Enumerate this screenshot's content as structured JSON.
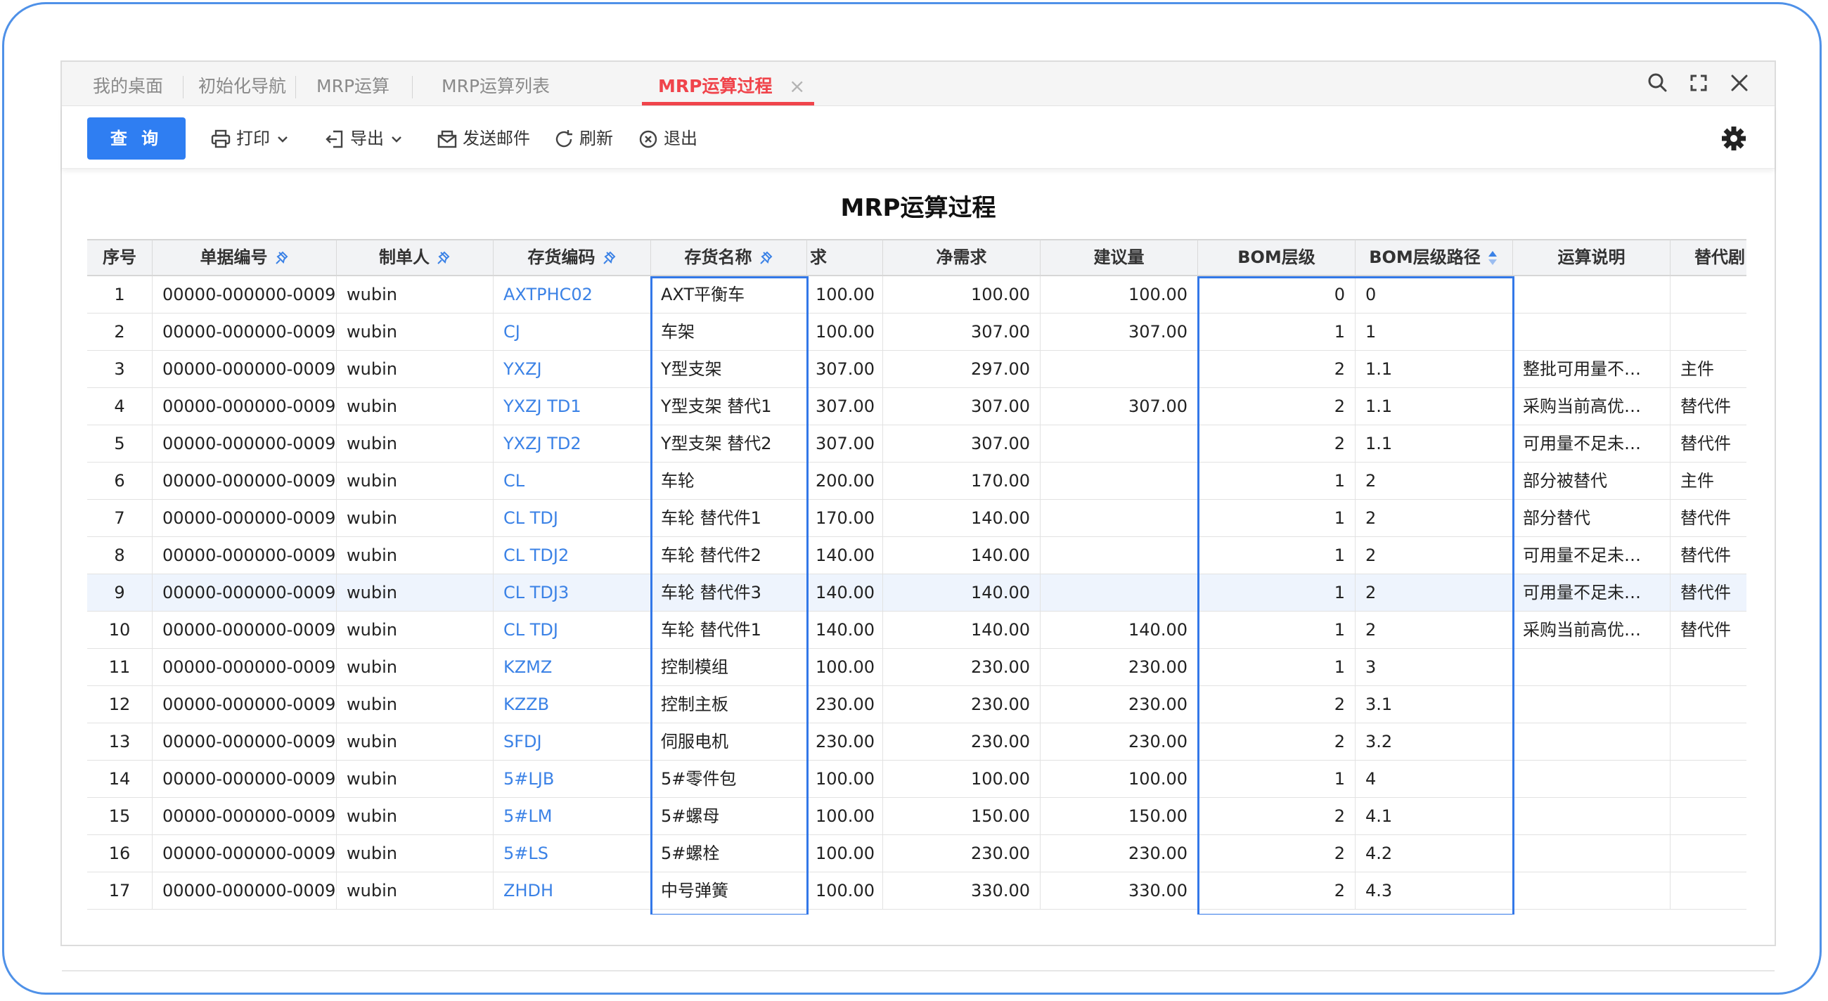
{
  "tabs": [
    {
      "label": "我的桌面",
      "active": false
    },
    {
      "label": "初始化导航",
      "active": false
    },
    {
      "label": "MRP运算",
      "active": false
    },
    {
      "label": "MRP运算列表",
      "active": false
    },
    {
      "label": "MRP运算过程",
      "active": true
    }
  ],
  "toolbar": {
    "query": "查 询",
    "print": "打印",
    "export": "导出",
    "email": "发送邮件",
    "refresh": "刷新",
    "exit": "退出"
  },
  "report_title": "MRP运算过程",
  "columns": {
    "seq": "序号",
    "doc_no": "单据编号",
    "maker": "制单人",
    "inv_code": "存货编码",
    "inv_name": "存货名称",
    "gross": "求",
    "net": "净需求",
    "suggest": "建议量",
    "bom_level": "BOM层级",
    "bom_path": "BOM层级路径",
    "note": "运算说明",
    "substitute": "替代剧"
  },
  "rows": [
    {
      "seq": "1",
      "doc_no": "00000-000000-0009",
      "maker": "wubin",
      "inv_code": "AXTPHC02",
      "inv_name": "AXT平衡车",
      "gross": "100.00",
      "net": "100.00",
      "suggest": "100.00",
      "bom_level": "0",
      "bom_path": "0",
      "note": "",
      "substitute": ""
    },
    {
      "seq": "2",
      "doc_no": "00000-000000-0009",
      "maker": "wubin",
      "inv_code": "CJ",
      "inv_name": "车架",
      "gross": "100.00",
      "net": "307.00",
      "suggest": "307.00",
      "bom_level": "1",
      "bom_path": "1",
      "note": "",
      "substitute": ""
    },
    {
      "seq": "3",
      "doc_no": "00000-000000-0009",
      "maker": "wubin",
      "inv_code": "YXZJ",
      "inv_name": "Y型支架",
      "gross": "307.00",
      "net": "297.00",
      "suggest": "",
      "bom_level": "2",
      "bom_path": "1.1",
      "note": "整批可用量不…",
      "substitute": "主件"
    },
    {
      "seq": "4",
      "doc_no": "00000-000000-0009",
      "maker": "wubin",
      "inv_code": "YXZJ TD1",
      "inv_name": "Y型支架 替代1",
      "gross": "307.00",
      "net": "307.00",
      "suggest": "307.00",
      "bom_level": "2",
      "bom_path": "1.1",
      "note": "采购当前高优…",
      "substitute": "替代件"
    },
    {
      "seq": "5",
      "doc_no": "00000-000000-0009",
      "maker": "wubin",
      "inv_code": "YXZJ TD2",
      "inv_name": "Y型支架 替代2",
      "gross": "307.00",
      "net": "307.00",
      "suggest": "",
      "bom_level": "2",
      "bom_path": "1.1",
      "note": "可用量不足未…",
      "substitute": "替代件"
    },
    {
      "seq": "6",
      "doc_no": "00000-000000-0009",
      "maker": "wubin",
      "inv_code": "CL",
      "inv_name": "车轮",
      "gross": "200.00",
      "net": "170.00",
      "suggest": "",
      "bom_level": "1",
      "bom_path": "2",
      "note": "部分被替代",
      "substitute": "主件"
    },
    {
      "seq": "7",
      "doc_no": "00000-000000-0009",
      "maker": "wubin",
      "inv_code": "CL TDJ",
      "inv_name": "车轮 替代件1",
      "gross": "170.00",
      "net": "140.00",
      "suggest": "",
      "bom_level": "1",
      "bom_path": "2",
      "note": "部分替代",
      "substitute": "替代件"
    },
    {
      "seq": "8",
      "doc_no": "00000-000000-0009",
      "maker": "wubin",
      "inv_code": "CL TDJ2",
      "inv_name": "车轮 替代件2",
      "gross": "140.00",
      "net": "140.00",
      "suggest": "",
      "bom_level": "1",
      "bom_path": "2",
      "note": "可用量不足未…",
      "substitute": "替代件"
    },
    {
      "seq": "9",
      "doc_no": "00000-000000-0009",
      "maker": "wubin",
      "inv_code": "CL TDJ3",
      "inv_name": "车轮 替代件3",
      "gross": "140.00",
      "net": "140.00",
      "suggest": "",
      "bom_level": "1",
      "bom_path": "2",
      "note": "可用量不足未…",
      "substitute": "替代件"
    },
    {
      "seq": "10",
      "doc_no": "00000-000000-0009",
      "maker": "wubin",
      "inv_code": "CL TDJ",
      "inv_name": "车轮 替代件1",
      "gross": "140.00",
      "net": "140.00",
      "suggest": "140.00",
      "bom_level": "1",
      "bom_path": "2",
      "note": "采购当前高优…",
      "substitute": "替代件"
    },
    {
      "seq": "11",
      "doc_no": "00000-000000-0009",
      "maker": "wubin",
      "inv_code": "KZMZ",
      "inv_name": "控制模组",
      "gross": "100.00",
      "net": "230.00",
      "suggest": "230.00",
      "bom_level": "1",
      "bom_path": "3",
      "note": "",
      "substitute": ""
    },
    {
      "seq": "12",
      "doc_no": "00000-000000-0009",
      "maker": "wubin",
      "inv_code": "KZZB",
      "inv_name": "控制主板",
      "gross": "230.00",
      "net": "230.00",
      "suggest": "230.00",
      "bom_level": "2",
      "bom_path": "3.1",
      "note": "",
      "substitute": ""
    },
    {
      "seq": "13",
      "doc_no": "00000-000000-0009",
      "maker": "wubin",
      "inv_code": "SFDJ",
      "inv_name": "伺服电机",
      "gross": "230.00",
      "net": "230.00",
      "suggest": "230.00",
      "bom_level": "2",
      "bom_path": "3.2",
      "note": "",
      "substitute": ""
    },
    {
      "seq": "14",
      "doc_no": "00000-000000-0009",
      "maker": "wubin",
      "inv_code": "5#LJB",
      "inv_name": "5#零件包",
      "gross": "100.00",
      "net": "100.00",
      "suggest": "100.00",
      "bom_level": "1",
      "bom_path": "4",
      "note": "",
      "substitute": ""
    },
    {
      "seq": "15",
      "doc_no": "00000-000000-0009",
      "maker": "wubin",
      "inv_code": "5#LM",
      "inv_name": "5#螺母",
      "gross": "100.00",
      "net": "150.00",
      "suggest": "150.00",
      "bom_level": "2",
      "bom_path": "4.1",
      "note": "",
      "substitute": ""
    },
    {
      "seq": "16",
      "doc_no": "00000-000000-0009",
      "maker": "wubin",
      "inv_code": "5#LS",
      "inv_name": "5#螺栓",
      "gross": "100.00",
      "net": "230.00",
      "suggest": "230.00",
      "bom_level": "2",
      "bom_path": "4.2",
      "note": "",
      "substitute": ""
    },
    {
      "seq": "17",
      "doc_no": "00000-000000-0009",
      "maker": "wubin",
      "inv_code": "ZHDH",
      "inv_name": "中号弹簧",
      "gross": "100.00",
      "net": "330.00",
      "suggest": "330.00",
      "bom_level": "2",
      "bom_path": "4.3",
      "note": "",
      "substitute": ""
    }
  ],
  "colors": {
    "accent": "#2f7ef2",
    "active_tab": "#f0444b",
    "link": "#3b82e6",
    "selection": "#3378e8",
    "header_bg": "#f2f3f5",
    "highlight_row": "#eef4fd"
  },
  "icons": [
    "search-icon",
    "fullscreen-icon",
    "close-icon",
    "printer-icon",
    "export-icon",
    "mail-icon",
    "refresh-icon",
    "exit-icon",
    "gear-icon",
    "pin-icon",
    "sort-icon",
    "chevron-down-icon"
  ]
}
